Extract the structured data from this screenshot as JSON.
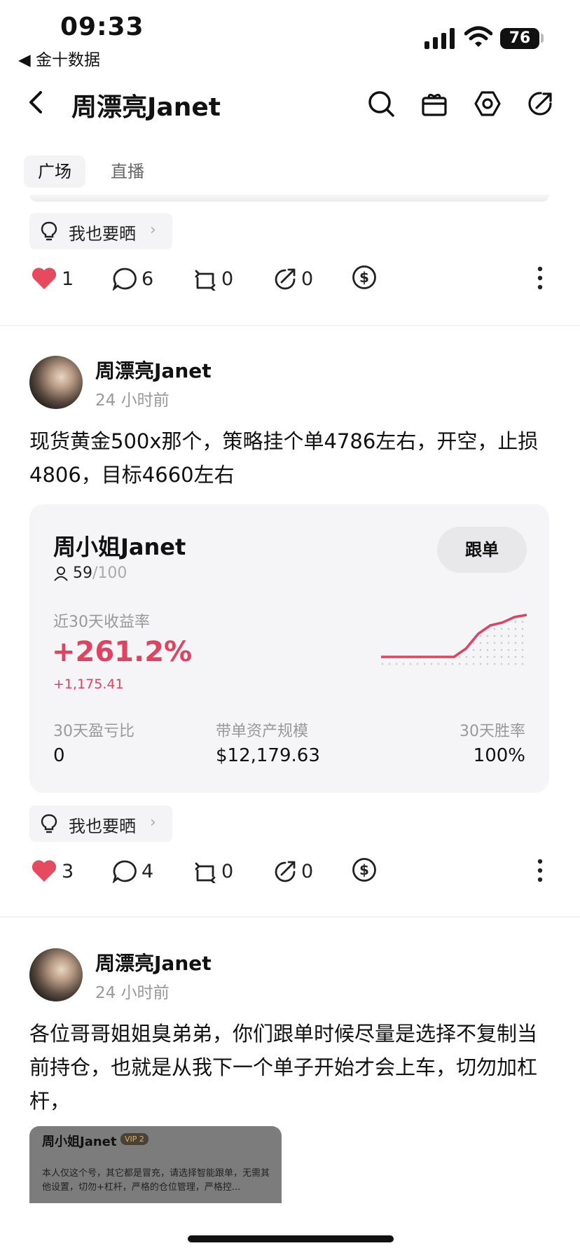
{
  "status_bar": {
    "time": "09:33",
    "back_app": "◀ 金十数据",
    "battery": "76"
  },
  "header": {
    "title": "周漂亮Janet"
  },
  "tabs": [
    {
      "label": "广场"
    },
    {
      "label": "直播"
    }
  ],
  "share_pill_label": "我也要晒",
  "post0_actions": {
    "likes": "1",
    "comments": "6",
    "reposts": "0",
    "shares": "0"
  },
  "post1": {
    "author": "周漂亮Janet",
    "time": "24 小时前",
    "text": "现货黄金500x那个，策略挂个单4786左右，开空，止损4806，目标4660左右",
    "card": {
      "name": "周小姐Janet",
      "follow_label": "跟单",
      "followers": "59",
      "followers_max": "/100",
      "roi_label": "近30天收益率",
      "roi": "+261.2%",
      "pnl": "+1,175.41",
      "stat1_label": "30天盈亏比",
      "stat1_value": "0",
      "stat2_label": "带单资产规模",
      "stat2_value": "$12,179.63",
      "stat3_label": "30天胜率",
      "stat3_value": "100%"
    },
    "actions": {
      "likes": "3",
      "comments": "4",
      "reposts": "0",
      "shares": "0"
    }
  },
  "post2": {
    "author": "周漂亮Janet",
    "time": "24 小时前",
    "text": "各位哥哥姐姐臭弟弟，你们跟单时候尽量是选择不复制当前持仓，也就是从我下一个单子开始才会上车，切勿加杠杆，",
    "preview": {
      "name": "周小姐Janet",
      "vip": "VIP 2",
      "text": "本人仅这个号，其它都是冒充，请选择智能跟单，无需其他设置，切勿+杠杆，严格的仓位管理，严格控..."
    }
  },
  "colors": {
    "accent_red": "#e0435f",
    "like_red": "#e64a5f",
    "chart_green": "#5aa469"
  },
  "mini_chart": {
    "y": [
      0,
      0,
      0,
      0,
      0,
      0,
      0,
      0.2,
      0.55,
      0.75,
      0.82,
      0.95,
      1.0
    ]
  }
}
